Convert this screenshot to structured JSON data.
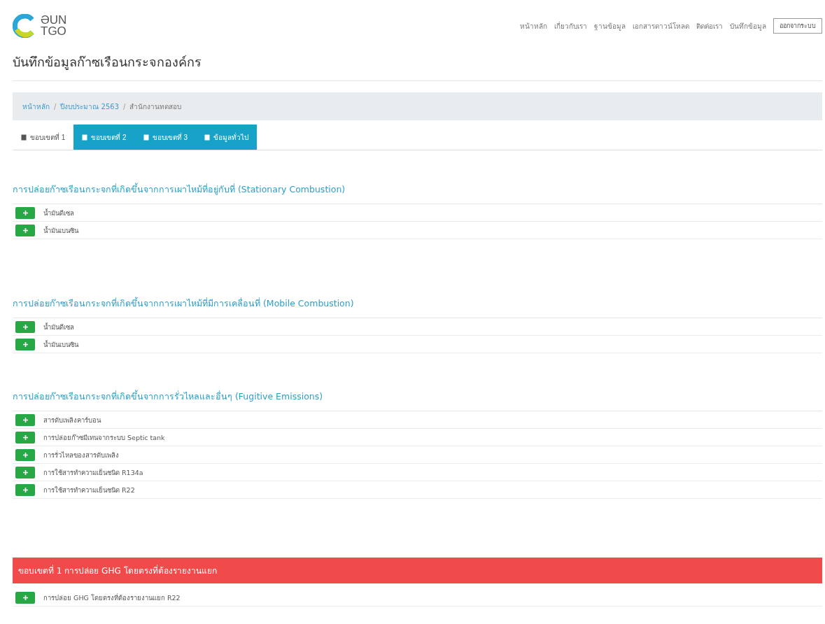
{
  "logo": {
    "word_top": "ƏUN",
    "word_bottom": "TGO"
  },
  "nav": {
    "links": [
      "หน้าหลัก",
      "เกี่ยวกับเรา",
      "ฐานข้อมูล",
      "เอกสารดาวน์โหลด",
      "ติดต่อเรา",
      "บันทึกข้อมูล"
    ],
    "button": "ออกจากระบบ"
  },
  "page_title": "บันทึกข้อมูลก๊าซเรือนกระจกองค์กร",
  "breadcrumb_separator": "/",
  "breadcrumb": [
    {
      "label": "หน้าหลัก",
      "link": true
    },
    {
      "label": "ปีงบประมาณ 2563",
      "link": true
    },
    {
      "label": "สำนักงานทดสอบ",
      "link": false
    }
  ],
  "tabs": [
    {
      "label": "ขอบเขตที่ 1",
      "selected": true
    },
    {
      "label": "ขอบเขตที่ 2",
      "selected": false
    },
    {
      "label": "ขอบเขตที่ 3",
      "selected": false
    },
    {
      "label": "ข้อมูลทั่วไป",
      "selected": false
    }
  ],
  "sections": [
    {
      "kind": "heading",
      "title": "การปล่อยก๊าซเรือนกระจกที่เกิดขึ้นจากการเผาไหม้ที่อยู่กับที่ (Stationary Combustion)",
      "items": [
        "น้ำมันดีเซล",
        "น้ำมันเบนซิน"
      ]
    },
    {
      "kind": "heading",
      "title": "การปล่อยก๊าซเรือนกระจกที่เกิดขึ้นจากการเผาไหม้ที่มีการเคลื่อนที่ (Mobile Combustion)",
      "items": [
        "น้ำมันดีเซล",
        "น้ำมันเบนซิน"
      ]
    },
    {
      "kind": "heading",
      "title": "การปล่อยก๊าซเรือนกระจกที่เกิดขึ้นจากการรั่วไหลและอื่นๆ (Fugitive Emissions)",
      "items": [
        "สารดับเพลิงคาร์บอน",
        "การปล่อยก๊าซมีเทนจากระบบ Septic tank",
        "การรั่วไหลของสารดับเพลิง",
        "การใช้สารทำความเย็นชนิด R134a",
        "การใช้สารทำความเย็นชนิด R22"
      ]
    },
    {
      "kind": "alert",
      "title": "ขอบเขตที่ 1 การปล่อย GHG โดยตรงที่ต้องรายงานแยก",
      "items": [
        "การปล่อย GHG โดยตรงที่ต้องรายงานแยก R22"
      ]
    }
  ]
}
